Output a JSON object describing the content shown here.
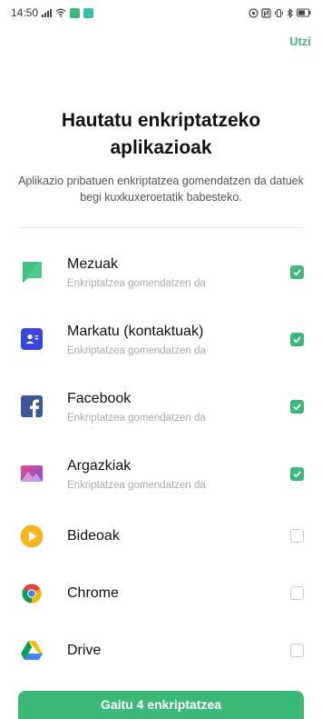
{
  "status_bar": {
    "time": "14:50"
  },
  "header": {
    "skip_label": "Utzi"
  },
  "main": {
    "title": "Hautatu enkriptatzeko aplikazioak",
    "subtitle": "Aplikazio pribatuen enkriptatzea gomendatzen da datuek begi kuxkuxeroetatik babesteko."
  },
  "apps": [
    {
      "name": "Mezuak",
      "desc": "Enkriptatzea gomendatzen da",
      "checked": true,
      "icon": "messages-icon"
    },
    {
      "name": "Markatu (kontaktuak)",
      "desc": "Enkriptatzea gomendatzen da",
      "checked": true,
      "icon": "contacts-icon"
    },
    {
      "name": "Facebook",
      "desc": "Enkriptatzea gomendatzen da",
      "checked": true,
      "icon": "facebook-icon"
    },
    {
      "name": "Argazkiak",
      "desc": "Enkriptatzea gomendatzen da",
      "checked": true,
      "icon": "photos-icon"
    },
    {
      "name": "Bideoak",
      "checked": false,
      "icon": "videos-icon"
    },
    {
      "name": "Chrome",
      "checked": false,
      "icon": "chrome-icon"
    },
    {
      "name": "Drive",
      "checked": false,
      "icon": "drive-icon"
    }
  ],
  "footer": {
    "button_label": "Gaitu 4 enkriptatzea"
  },
  "colors": {
    "accent": "#3cb878"
  }
}
